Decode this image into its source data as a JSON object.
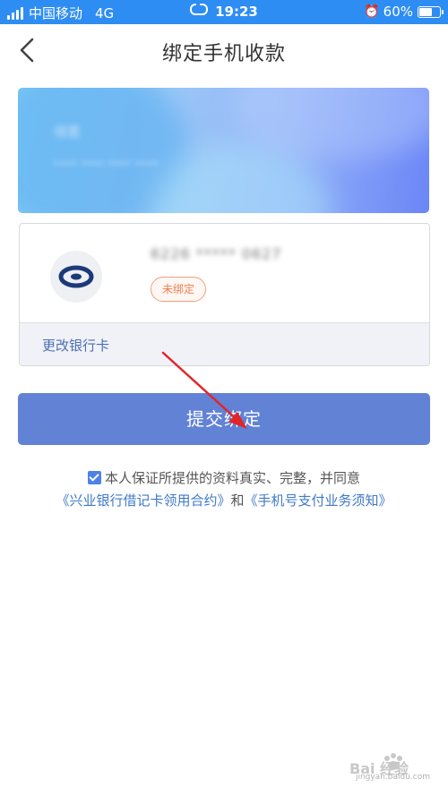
{
  "status_bar": {
    "carrier": "中国移动",
    "network": "4G",
    "time": "19:23",
    "battery_percent": "60%",
    "battery_level": 0.6
  },
  "nav": {
    "title": "绑定手机收款",
    "back_icon": "chevron-left-icon"
  },
  "banner": {
    "blurred_line1": "储蓄",
    "blurred_line2": "**** **** **** ****"
  },
  "card": {
    "masked_number": "6226 ***** 0627",
    "status_badge": "未绑定",
    "change_bank_label": "更改银行卡",
    "logo_icon": "cib-bank-logo-icon"
  },
  "submit_button": {
    "label": "提交绑定"
  },
  "agreement": {
    "checked": true,
    "text_line1": "本人保证所提供的资料真实、完整，并同意",
    "link1": "《兴业银行借记卡领用合约》",
    "conjunction": "和",
    "link2": "《手机号支付业务须知》"
  },
  "watermark": {
    "text": "jingyan.baidu.com",
    "logo_text": "Bai 经验"
  },
  "colors": {
    "status_bar": "#2e8df3",
    "submit_button": "#6282d6",
    "link": "#3f79c8",
    "badge": "#ef7f4f",
    "arrow": "#e0262a"
  }
}
